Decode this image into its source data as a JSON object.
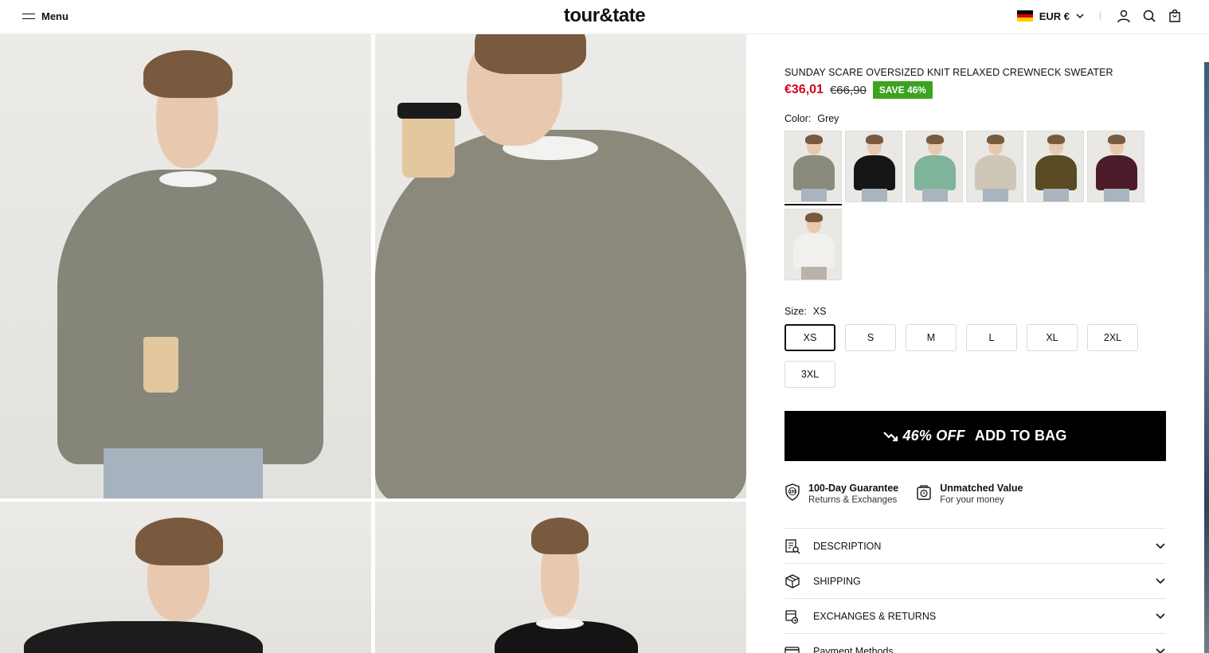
{
  "header": {
    "menu_label": "Menu",
    "logo": "tour&tate",
    "currency": "EUR €",
    "flag_colors": [
      "#000000",
      "#dd0000",
      "#ffce00"
    ],
    "icons": [
      "account-icon",
      "search-icon",
      "cart-icon"
    ]
  },
  "product": {
    "title": "SUNDAY SCARE OVERSIZED KNIT RELAXED CREWNECK SWEATER",
    "price": "€36,01",
    "compare_price": "€66,90",
    "save_badge": "SAVE 46%",
    "color_label": "Color:",
    "color_value": "Grey",
    "swatches": [
      {
        "name": "Grey",
        "color": "#8a8a7d",
        "selected": true
      },
      {
        "name": "Black",
        "color": "#161616",
        "selected": false
      },
      {
        "name": "Green",
        "color": "#7fb39a",
        "selected": false
      },
      {
        "name": "Beige",
        "color": "#cfc7b6",
        "selected": false
      },
      {
        "name": "Brown",
        "color": "#5a4a24",
        "selected": false
      },
      {
        "name": "Burgundy",
        "color": "#4d1c2a",
        "selected": false
      },
      {
        "name": "White",
        "color": "#f1f0ec",
        "selected": false
      }
    ],
    "size_label": "Size:",
    "size_value": "XS",
    "sizes": [
      "XS",
      "S",
      "M",
      "L",
      "XL",
      "2XL",
      "3XL"
    ],
    "selected_size": "XS",
    "bag_button": {
      "discount": "46% OFF",
      "label": "ADD TO BAG"
    },
    "badges": [
      {
        "title": "100-Day Guarantee",
        "subtitle": "Returns & Exchanges",
        "icon": "shield-100-icon"
      },
      {
        "title": "Unmatched Value",
        "subtitle": "For your money",
        "icon": "value-tag-icon"
      }
    ],
    "accordions": [
      {
        "label": "DESCRIPTION",
        "icon": "description-icon"
      },
      {
        "label": "SHIPPING",
        "icon": "box-icon"
      },
      {
        "label": "EXCHANGES & RETURNS",
        "icon": "exchange-icon"
      },
      {
        "label": "Payment Methods",
        "icon": "card-icon"
      }
    ]
  },
  "colors": {
    "sale_red": "#d0021b",
    "save_green": "#3ca21f",
    "button_black": "#000000"
  }
}
